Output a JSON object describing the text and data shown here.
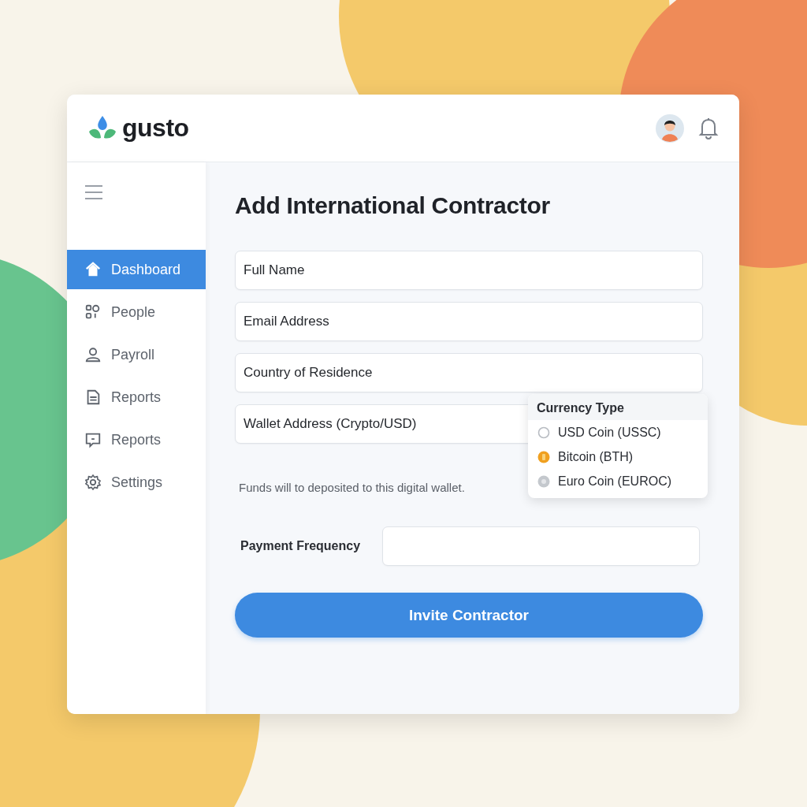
{
  "header": {
    "brand": "gusto"
  },
  "sidebar": {
    "items": [
      {
        "label": "Dashboard",
        "kind": "home",
        "selected": true
      },
      {
        "label": "People",
        "kind": "people",
        "selected": false
      },
      {
        "label": "Payroll",
        "kind": "person",
        "selected": false
      },
      {
        "label": "Reports",
        "kind": "document",
        "selected": false
      },
      {
        "label": "Reports",
        "kind": "chat",
        "selected": false
      },
      {
        "label": "Settings",
        "kind": "gear",
        "selected": false
      }
    ]
  },
  "form": {
    "title": "Add International Contractor",
    "fields": [
      {
        "placeholder": "Full Name"
      },
      {
        "placeholder": "Email Address"
      },
      {
        "placeholder": "Country of Residence"
      },
      {
        "placeholder": "Wallet Address (Crypto/USD)"
      }
    ],
    "hint": "Funds will to deposited to this digital wallet.",
    "currency_menu": {
      "title": "Currency Type",
      "options": [
        {
          "label": "USD Coin (USSC)",
          "kind": "outline",
          "selected": false
        },
        {
          "label": "Bitcoin (BTH)",
          "kind": "coin",
          "selected": true
        },
        {
          "label": "Euro Coin (EUROC)",
          "kind": "coin",
          "selected": false
        }
      ]
    },
    "payment_frequency": {
      "label": "Payment Frequency"
    },
    "submit": "Invite Contractor"
  }
}
